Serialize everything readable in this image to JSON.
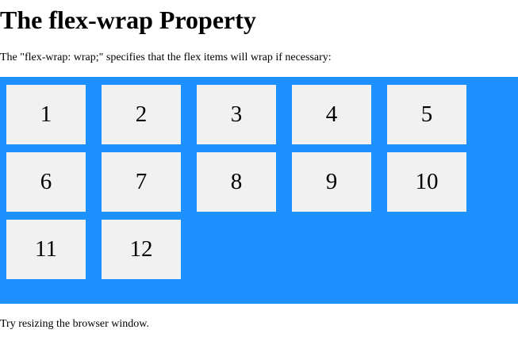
{
  "page": {
    "title": "The flex-wrap Property",
    "intro": "The \"flex-wrap: wrap;\" specifies that the flex items will wrap if necessary:",
    "footer": "Try resizing the browser window."
  },
  "colors": {
    "container_bg": "#1E90FF",
    "item_bg": "#F1F1F1",
    "text": "#000000",
    "page_bg": "#FFFFFF"
  },
  "flex_items": [
    "1",
    "2",
    "3",
    "4",
    "5",
    "6",
    "7",
    "8",
    "9",
    "10",
    "11",
    "12"
  ]
}
